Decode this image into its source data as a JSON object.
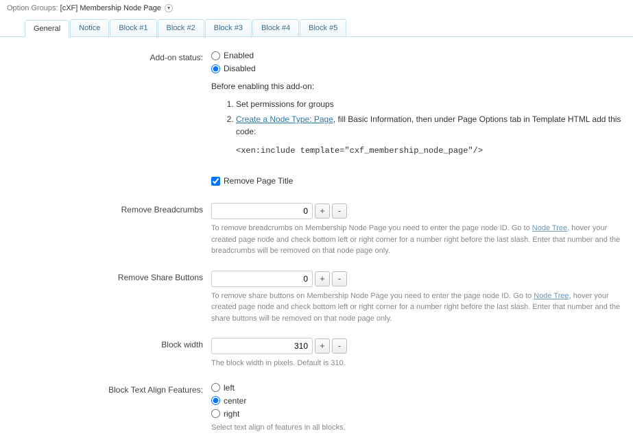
{
  "header": {
    "groups_label": "Option Groups:",
    "group_name": "[cXF] Membership Node Page"
  },
  "tabs": [
    {
      "label": "General"
    },
    {
      "label": "Notice"
    },
    {
      "label": "Block #1"
    },
    {
      "label": "Block #2"
    },
    {
      "label": "Block #3"
    },
    {
      "label": "Block #4"
    },
    {
      "label": "Block #5"
    }
  ],
  "addon_status": {
    "label": "Add-on status:",
    "opt_enabled": "Enabled",
    "opt_disabled": "Disabled",
    "intro": "Before enabling this add-on:",
    "step1": "Set permissions for groups",
    "step2_link": "Create a Node Type: Page",
    "step2_rest": ", fill Basic Information, then under Page Options tab in Template HTML add this code:",
    "code": "<xen:include template=\"cxf_membership_node_page\"/>"
  },
  "remove_title": {
    "label": "Remove Page Title"
  },
  "remove_breadcrumbs": {
    "label": "Remove Breadcrumbs",
    "value": "0",
    "help_a": "To remove breadcrumbs on Membership Node Page you need to enter the page node ID. Go to ",
    "help_link": "Node Tree",
    "help_b": ", hover your created page node and check bottom left or right corner for a number right before the last slash. Enter that number and the breadcrumbs will be removed on that node page only."
  },
  "remove_share": {
    "label": "Remove Share Buttons",
    "value": "0",
    "help_a": "To remove share buttons on Membership Node Page you need to enter the page node ID. Go to ",
    "help_link": "Node Tree",
    "help_b": ", hover your created page node and check bottom left or right corner for a number right before the last slash. Enter that number and the share buttons will be removed on that node page only."
  },
  "block_width": {
    "label": "Block width",
    "value": "310",
    "help": "The block width in pixels. Default is 310."
  },
  "text_align": {
    "label": "Block Text Align Features:",
    "opt_left": "left",
    "opt_center": "center",
    "opt_right": "right",
    "help": "Select text align of features in all blocks."
  },
  "btn": {
    "plus": "+",
    "minus": "-"
  }
}
